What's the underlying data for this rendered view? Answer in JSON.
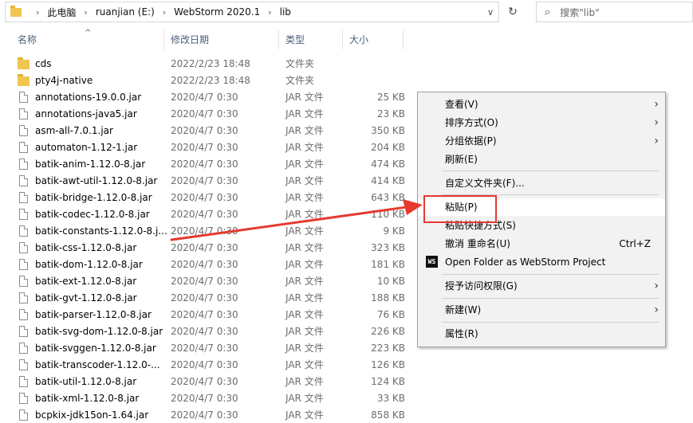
{
  "address": {
    "breadcrumbs": [
      "此电脑",
      "ruanjian (E:)",
      "WebStorm 2020.1",
      "lib"
    ],
    "search_placeholder": "搜索\"lib\""
  },
  "columns": {
    "name": "名称",
    "date": "修改日期",
    "type": "类型",
    "size": "大小"
  },
  "files": [
    {
      "name": "cds",
      "date": "2022/2/23 18:48",
      "type": "文件夹",
      "size": "",
      "kind": "folder"
    },
    {
      "name": "pty4j-native",
      "date": "2022/2/23 18:48",
      "type": "文件夹",
      "size": "",
      "kind": "folder"
    },
    {
      "name": "annotations-19.0.0.jar",
      "date": "2020/4/7 0:30",
      "type": "JAR 文件",
      "size": "25 KB",
      "kind": "file"
    },
    {
      "name": "annotations-java5.jar",
      "date": "2020/4/7 0:30",
      "type": "JAR 文件",
      "size": "23 KB",
      "kind": "file"
    },
    {
      "name": "asm-all-7.0.1.jar",
      "date": "2020/4/7 0:30",
      "type": "JAR 文件",
      "size": "350 KB",
      "kind": "file"
    },
    {
      "name": "automaton-1.12-1.jar",
      "date": "2020/4/7 0:30",
      "type": "JAR 文件",
      "size": "204 KB",
      "kind": "file"
    },
    {
      "name": "batik-anim-1.12.0-8.jar",
      "date": "2020/4/7 0:30",
      "type": "JAR 文件",
      "size": "474 KB",
      "kind": "file"
    },
    {
      "name": "batik-awt-util-1.12.0-8.jar",
      "date": "2020/4/7 0:30",
      "type": "JAR 文件",
      "size": "414 KB",
      "kind": "file"
    },
    {
      "name": "batik-bridge-1.12.0-8.jar",
      "date": "2020/4/7 0:30",
      "type": "JAR 文件",
      "size": "643 KB",
      "kind": "file"
    },
    {
      "name": "batik-codec-1.12.0-8.jar",
      "date": "2020/4/7 0:30",
      "type": "JAR 文件",
      "size": "110 KB",
      "kind": "file"
    },
    {
      "name": "batik-constants-1.12.0-8.j...",
      "date": "2020/4/7 0:30",
      "type": "JAR 文件",
      "size": "9 KB",
      "kind": "file"
    },
    {
      "name": "batik-css-1.12.0-8.jar",
      "date": "2020/4/7 0:30",
      "type": "JAR 文件",
      "size": "323 KB",
      "kind": "file"
    },
    {
      "name": "batik-dom-1.12.0-8.jar",
      "date": "2020/4/7 0:30",
      "type": "JAR 文件",
      "size": "181 KB",
      "kind": "file"
    },
    {
      "name": "batik-ext-1.12.0-8.jar",
      "date": "2020/4/7 0:30",
      "type": "JAR 文件",
      "size": "10 KB",
      "kind": "file"
    },
    {
      "name": "batik-gvt-1.12.0-8.jar",
      "date": "2020/4/7 0:30",
      "type": "JAR 文件",
      "size": "188 KB",
      "kind": "file"
    },
    {
      "name": "batik-parser-1.12.0-8.jar",
      "date": "2020/4/7 0:30",
      "type": "JAR 文件",
      "size": "76 KB",
      "kind": "file"
    },
    {
      "name": "batik-svg-dom-1.12.0-8.jar",
      "date": "2020/4/7 0:30",
      "type": "JAR 文件",
      "size": "226 KB",
      "kind": "file"
    },
    {
      "name": "batik-svggen-1.12.0-8.jar",
      "date": "2020/4/7 0:30",
      "type": "JAR 文件",
      "size": "223 KB",
      "kind": "file"
    },
    {
      "name": "batik-transcoder-1.12.0-...",
      "date": "2020/4/7 0:30",
      "type": "JAR 文件",
      "size": "126 KB",
      "kind": "file"
    },
    {
      "name": "batik-util-1.12.0-8.jar",
      "date": "2020/4/7 0:30",
      "type": "JAR 文件",
      "size": "124 KB",
      "kind": "file"
    },
    {
      "name": "batik-xml-1.12.0-8.jar",
      "date": "2020/4/7 0:30",
      "type": "JAR 文件",
      "size": "33 KB",
      "kind": "file"
    },
    {
      "name": "bcpkix-jdk15on-1.64.jar",
      "date": "2020/4/7 0:30",
      "type": "JAR 文件",
      "size": "858 KB",
      "kind": "file"
    }
  ],
  "context_menu": {
    "view": "查看(V)",
    "sort": "排序方式(O)",
    "group": "分组依据(P)",
    "refresh": "刷新(E)",
    "customize": "自定义文件夹(F)...",
    "paste": "粘贴(P)",
    "paste_shortcut": "粘贴快捷方式(S)",
    "undo_rename": "撤消 重命名(U)",
    "undo_shortcut": "Ctrl+Z",
    "open_webstorm": "Open Folder as WebStorm Project",
    "webstorm_icon_text": "WS",
    "grant_access": "授予访问权限(G)",
    "new": "新建(W)",
    "properties": "属性(R)"
  },
  "colors": {
    "annotation_red": "#e53a30",
    "folder_yellow": "#f1c550",
    "menu_bg": "#f2f2f2"
  }
}
